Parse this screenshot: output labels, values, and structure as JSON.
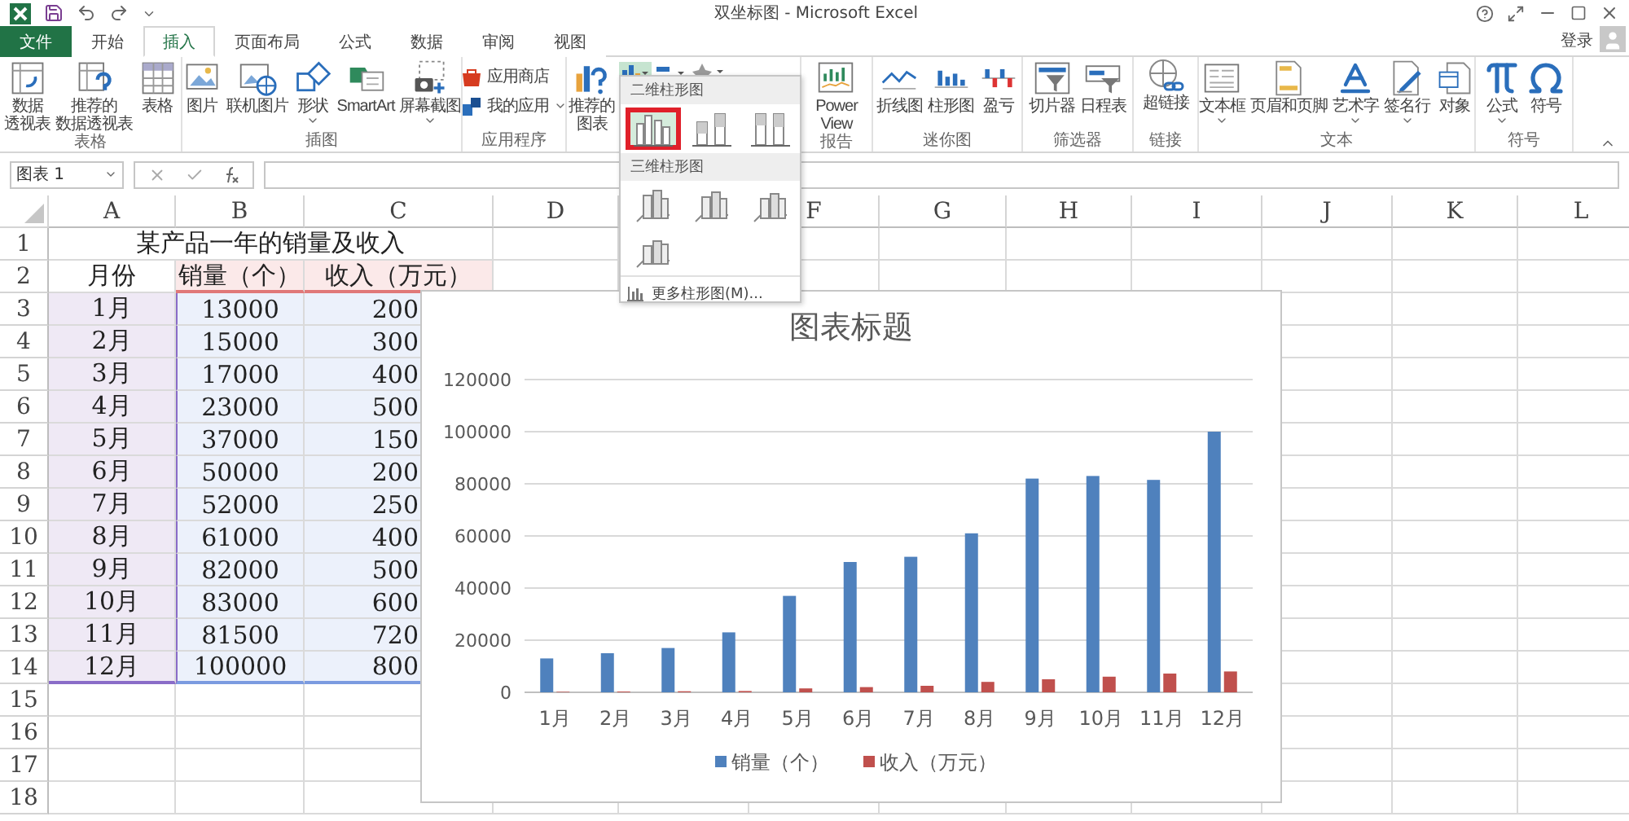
{
  "window": {
    "title": "双坐标图 - Microsoft Excel",
    "sign_in": "登录"
  },
  "tabs": [
    {
      "label": "文件",
      "kind": "file",
      "selected": false
    },
    {
      "label": "开始",
      "kind": "tab",
      "selected": false
    },
    {
      "label": "插入",
      "kind": "tab",
      "selected": true
    },
    {
      "label": "页面布局",
      "kind": "tab",
      "selected": false
    },
    {
      "label": "公式",
      "kind": "tab",
      "selected": false
    },
    {
      "label": "数据",
      "kind": "tab",
      "selected": false
    },
    {
      "label": "审阅",
      "kind": "tab",
      "selected": false
    },
    {
      "label": "视图",
      "kind": "tab",
      "selected": false
    }
  ],
  "ribbon": {
    "groups": [
      {
        "label": "表格",
        "buttons": [
          {
            "lines": [
              "数据",
              "透视表"
            ],
            "kind": "large",
            "dropdown": false
          },
          {
            "lines": [
              "推荐的",
              "数据透视表"
            ],
            "kind": "large",
            "dropdown": false
          },
          {
            "label": "表格",
            "kind": "large",
            "dropdown": false
          }
        ]
      },
      {
        "label": "插图",
        "buttons": [
          {
            "label": "图片",
            "kind": "large",
            "dropdown": false
          },
          {
            "label": "联机图片",
            "kind": "large",
            "dropdown": false
          },
          {
            "label": "形状",
            "kind": "large",
            "dropdown": true
          },
          {
            "label": "SmartArt",
            "kind": "large",
            "dropdown": false
          },
          {
            "label": "屏幕截图",
            "kind": "large",
            "dropdown": true
          }
        ]
      },
      {
        "label": "应用程序",
        "buttons": [
          {
            "label": "应用商店",
            "kind": "small",
            "dropdown": false
          },
          {
            "label": "我的应用",
            "kind": "small",
            "dropdown": true
          }
        ]
      },
      {
        "buttons": [
          {
            "lines": [
              "推荐的",
              "图表"
            ],
            "kind": "large",
            "dropdown": false
          },
          {
            "kind": "chart-types"
          }
        ]
      },
      {
        "label": "报告",
        "buttons": [
          {
            "lines": [
              "Power",
              "View"
            ],
            "kind": "large",
            "dropdown": false
          }
        ]
      },
      {
        "label": "迷你图",
        "buttons": [
          {
            "label": "折线图",
            "kind": "large",
            "dropdown": false
          },
          {
            "label": "柱形图",
            "kind": "large",
            "dropdown": false
          },
          {
            "label": "盈亏",
            "kind": "large",
            "dropdown": false
          }
        ]
      },
      {
        "label": "筛选器",
        "buttons": [
          {
            "label": "切片器",
            "kind": "large",
            "dropdown": false
          },
          {
            "label": "日程表",
            "kind": "large",
            "dropdown": false
          }
        ]
      },
      {
        "label": "链接",
        "buttons": [
          {
            "label": "超链接",
            "kind": "large",
            "dropdown": false
          }
        ]
      },
      {
        "label": "文本",
        "buttons": [
          {
            "label": "文本框",
            "kind": "large",
            "dropdown": true
          },
          {
            "label": "页眉和页脚",
            "kind": "large",
            "dropdown": false
          },
          {
            "label": "艺术字",
            "kind": "large",
            "dropdown": true
          },
          {
            "label": "签名行",
            "kind": "large",
            "dropdown": true
          },
          {
            "label": "对象",
            "kind": "large",
            "dropdown": false
          }
        ]
      },
      {
        "label": "符号",
        "buttons": [
          {
            "label": "公式",
            "kind": "large",
            "dropdown": true
          },
          {
            "label": "符号",
            "kind": "large",
            "dropdown": false
          }
        ]
      }
    ]
  },
  "name_box": {
    "value": "图表 1"
  },
  "sheet": {
    "columns": [
      "A",
      "B",
      "C",
      "D",
      "F",
      "G",
      "H",
      "I",
      "J",
      "K",
      "L"
    ],
    "rows": [
      {
        "header": "1",
        "title": "某产品一年的销量及收入"
      },
      {
        "header": "2",
        "cells": [
          "月份",
          "销量（个）",
          "收入（万元）"
        ]
      },
      {
        "header": "3",
        "cells": [
          "1月",
          "13000",
          "200"
        ]
      },
      {
        "header": "4",
        "cells": [
          "2月",
          "15000",
          "300"
        ]
      },
      {
        "header": "5",
        "cells": [
          "3月",
          "17000",
          "400"
        ]
      },
      {
        "header": "6",
        "cells": [
          "4月",
          "23000",
          "500"
        ]
      },
      {
        "header": "7",
        "cells": [
          "5月",
          "37000",
          "150"
        ]
      },
      {
        "header": "8",
        "cells": [
          "6月",
          "50000",
          "200"
        ]
      },
      {
        "header": "9",
        "cells": [
          "7月",
          "52000",
          "250"
        ]
      },
      {
        "header": "10",
        "cells": [
          "8月",
          "61000",
          "400"
        ]
      },
      {
        "header": "11",
        "cells": [
          "9月",
          "82000",
          "500"
        ]
      },
      {
        "header": "12",
        "cells": [
          "10月",
          "83000",
          "600"
        ]
      },
      {
        "header": "13",
        "cells": [
          "11月",
          "81500",
          "720"
        ]
      },
      {
        "header": "14",
        "cells": [
          "12月",
          "100000",
          "800"
        ]
      },
      {
        "header": "15"
      },
      {
        "header": "16"
      },
      {
        "header": "17"
      },
      {
        "header": "18"
      }
    ]
  },
  "chart_menu": {
    "sections": [
      {
        "label": "二维柱形图",
        "options": [
          {
            "selected": true
          },
          {
            "selected": false
          },
          {
            "selected": false
          }
        ]
      },
      {
        "label": "三维柱形图",
        "options": [
          {
            "selected": false
          },
          {
            "selected": false
          },
          {
            "selected": false
          },
          {
            "selected": false
          }
        ]
      }
    ],
    "more": "更多柱形图(M)..."
  },
  "chart": {
    "chart_data": {
      "type": "bar",
      "title": "图表标题",
      "categories": [
        "1月",
        "2月",
        "3月",
        "4月",
        "5月",
        "6月",
        "7月",
        "8月",
        "9月",
        "10月",
        "11月",
        "12月"
      ],
      "series": [
        {
          "name": "销量（个）",
          "color": "#4f81bd",
          "values": [
            13000,
            15000,
            17000,
            23000,
            37000,
            50000,
            52000,
            61000,
            82000,
            83000,
            81500,
            100000
          ]
        },
        {
          "name": "收入（万元）",
          "color": "#c0504d",
          "values": [
            200,
            300,
            400,
            500,
            1500,
            2000,
            2500,
            4000,
            5000,
            6000,
            7200,
            8000
          ]
        }
      ],
      "ylim": [
        0,
        120000
      ],
      "yticks": [
        0,
        20000,
        40000,
        60000,
        80000,
        100000,
        120000
      ],
      "grid": true,
      "legend": true
    }
  }
}
